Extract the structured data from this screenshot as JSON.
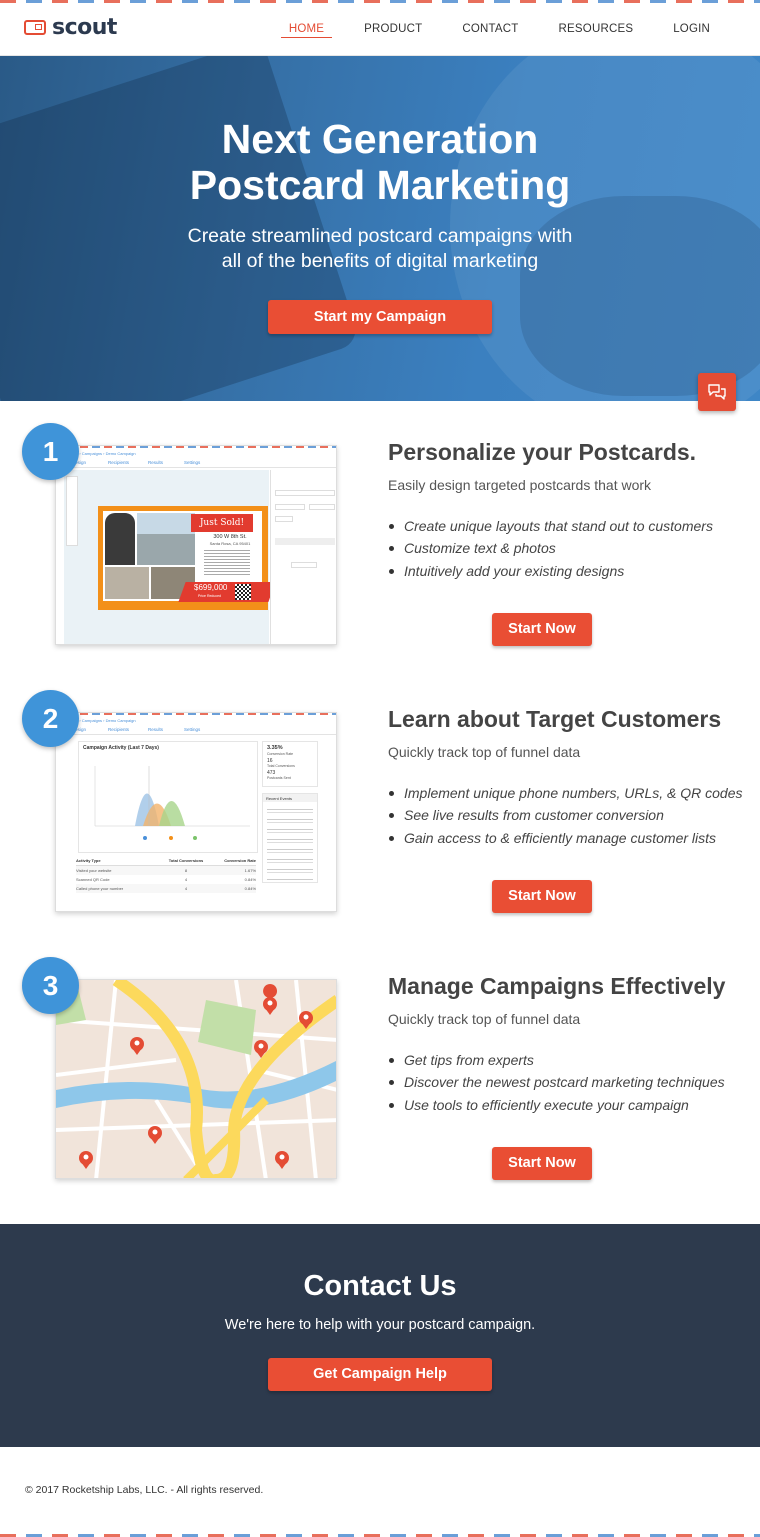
{
  "brand": {
    "name": "scout"
  },
  "nav": {
    "items": [
      {
        "label": "HOME",
        "active": true
      },
      {
        "label": "PRODUCT",
        "active": false
      },
      {
        "label": "CONTACT",
        "active": false
      },
      {
        "label": "RESOURCES",
        "active": false
      },
      {
        "label": "LOGIN",
        "active": false
      }
    ]
  },
  "hero": {
    "title_line1": "Next Generation",
    "title_line2": "Postcard Marketing",
    "subtitle_line1": "Create streamlined postcard campaigns with",
    "subtitle_line2": "all of the benefits of digital marketing",
    "cta": "Start my Campaign"
  },
  "chat": {
    "icon": "chat-bubbles-icon"
  },
  "features": [
    {
      "number": "1",
      "title": "Personalize your Postcards.",
      "subtitle": "Easily design targeted postcards that work",
      "bullets": [
        "Create unique layouts that stand out to customers",
        "Customize text & photos",
        "Intuitively add your existing designs"
      ],
      "cta": "Start Now",
      "shot": {
        "breadcrumb": "ard Studio  ›  Campaigns  ›  Demo Campaign",
        "tabs": [
          "Design",
          "Recipients",
          "Results",
          "Settings"
        ],
        "badge": "Just Sold!",
        "address": "300 W 8th St.",
        "city": "Santa Rosa, CA 95401",
        "price": "$699,000",
        "price_note": "Price Reduced"
      }
    },
    {
      "number": "2",
      "title": "Learn about Target Customers",
      "subtitle": "Quickly track top of funnel data",
      "bullets": [
        "Implement unique phone numbers, URLs, & QR codes",
        "See live results from customer conversion",
        "Gain access to & efficiently manage customer lists"
      ],
      "cta": "Start Now",
      "shot": {
        "breadcrumb": "ard Studio  ›  Campaigns  ›  Demo Campaign",
        "tabs": [
          "Design",
          "Recipients",
          "Results",
          "Settings"
        ],
        "chart_title": "Campaign Activity (Last 7 Days)",
        "stat_rate": "3.35%",
        "stat_rate_label": "Conversion Rate",
        "stat_conv": "16",
        "stat_conv_label": "Total Conversions",
        "stat_sent": "473",
        "stat_sent_label": "Postcards Sent",
        "events_title": "Recent Events",
        "table_headers": [
          "Activity Type",
          "Total Conversions",
          "Conversion Rate"
        ],
        "table_rows": [
          [
            "Visited your website",
            "8",
            "1.67%"
          ],
          [
            "Scanned QR Code",
            "4",
            "0.84%"
          ],
          [
            "Called phone your number",
            "4",
            "0.84%"
          ]
        ]
      }
    },
    {
      "number": "3",
      "title": "Manage Campaigns Effectively",
      "subtitle": "Quickly track top of funnel data",
      "bullets": [
        "Get tips from experts",
        "Discover the newest postcard marketing techniques",
        "Use tools to efficiently execute your campaign"
      ],
      "cta": "Start Now"
    }
  ],
  "contact": {
    "title": "Contact Us",
    "subtitle": "We're here to help with your postcard campaign.",
    "cta": "Get Campaign Help"
  },
  "footer": {
    "copyright": "© 2017 Rocketship Labs, LLC. - All rights reserved."
  },
  "colors": {
    "accent": "#e94e34",
    "badge": "#3f94d9",
    "dark": "#2d3a4d",
    "hero": "#3b80c0"
  }
}
